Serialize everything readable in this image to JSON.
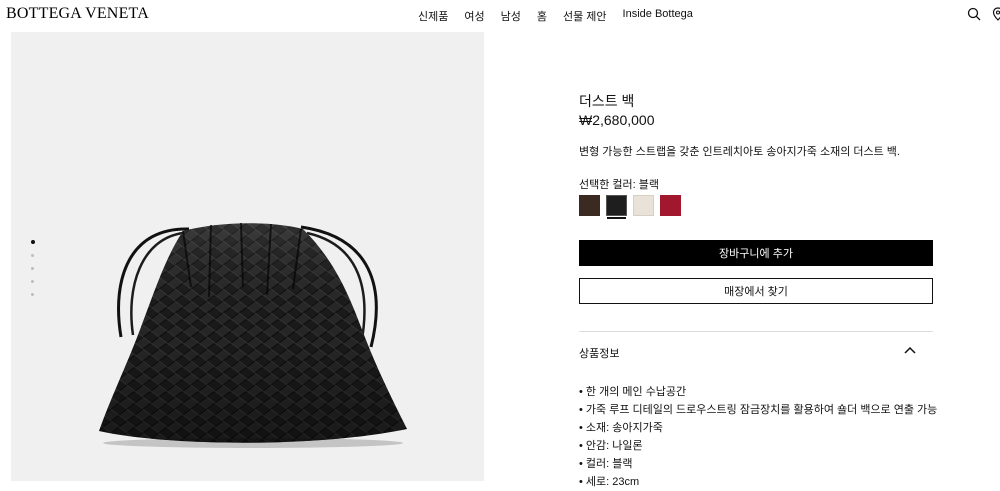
{
  "header": {
    "logo": "BOTTEGA VENETA",
    "nav": [
      "신제품",
      "여성",
      "남성",
      "홈",
      "선물 제안",
      "Inside Bottega"
    ]
  },
  "gallery": {
    "image_count": 5,
    "active_index": 0
  },
  "product": {
    "title": "더스트 백",
    "price": "₩2,680,000",
    "description": "변형 가능한 스트랩을 갖춘 인트레치아토 송아지가죽 소재의 더스트 백.",
    "selected_color_label": "선택한 컬러: 블랙",
    "swatches": [
      {
        "color": "#3b2a22",
        "selected": false
      },
      {
        "color": "#1e1e1e",
        "selected": true
      },
      {
        "color": "#e9e2d8",
        "selected": false
      },
      {
        "color": "#a0172e",
        "selected": false
      }
    ],
    "add_to_cart_label": "장바구니에 추가",
    "find_in_store_label": "매장에서 찾기",
    "info_title": "상품정보",
    "details": [
      "한 개의 메인 수납공간",
      "가죽 루프 디테일의 드로우스트링 잠금장치를 활용하여 숄더 백으로 연출 가능",
      "소재: 송아지가죽",
      "안감: 나일론",
      "컬러: 블랙",
      "세로: 23cm"
    ]
  },
  "icons": {
    "search": "search-icon",
    "store": "location-pin-icon",
    "collapse": "chevron-up-icon"
  }
}
